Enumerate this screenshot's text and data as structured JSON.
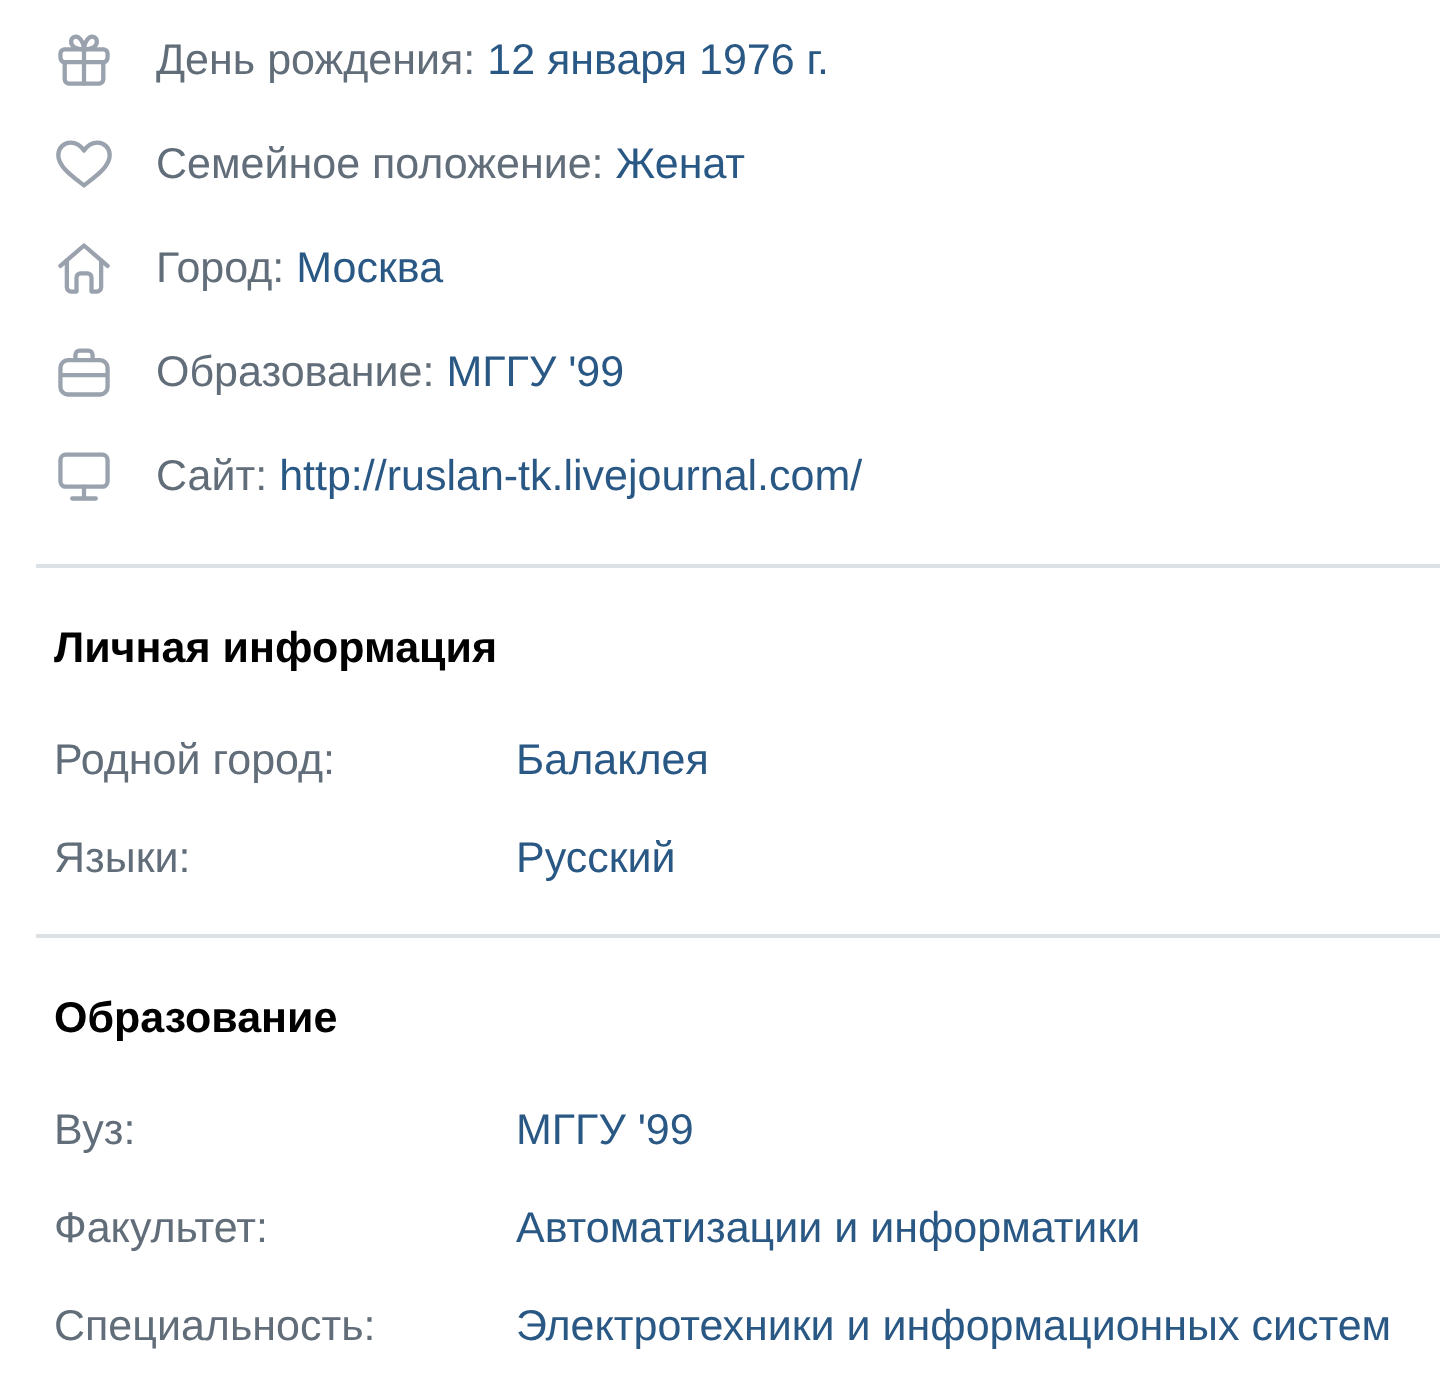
{
  "info": [
    {
      "kind": "gift",
      "label": "День рождения:",
      "value": "12 января 1976 г."
    },
    {
      "kind": "heart",
      "label": "Семейное положение:",
      "value": "Женат"
    },
    {
      "kind": "house",
      "label": "Город:",
      "value": "Москва"
    },
    {
      "kind": "briefcase",
      "label": "Образование:",
      "value": "МГГУ '99"
    },
    {
      "kind": "monitor",
      "label": "Сайт:",
      "value": "http://ruslan-tk.livejournal.com/"
    }
  ],
  "sections": [
    {
      "title": "Личная информация",
      "rows": [
        {
          "label": "Родной город:",
          "value": "Балаклея"
        },
        {
          "label": "Языки:",
          "value": "Русский"
        }
      ]
    },
    {
      "title": "Образование",
      "rows": [
        {
          "label": "Вуз:",
          "value": "МГГУ '99"
        },
        {
          "label": "Факультет:",
          "value": "Автоматизации и информатики"
        },
        {
          "label": "Специальность:",
          "value": "Электротехники и информационных систем"
        }
      ]
    }
  ]
}
